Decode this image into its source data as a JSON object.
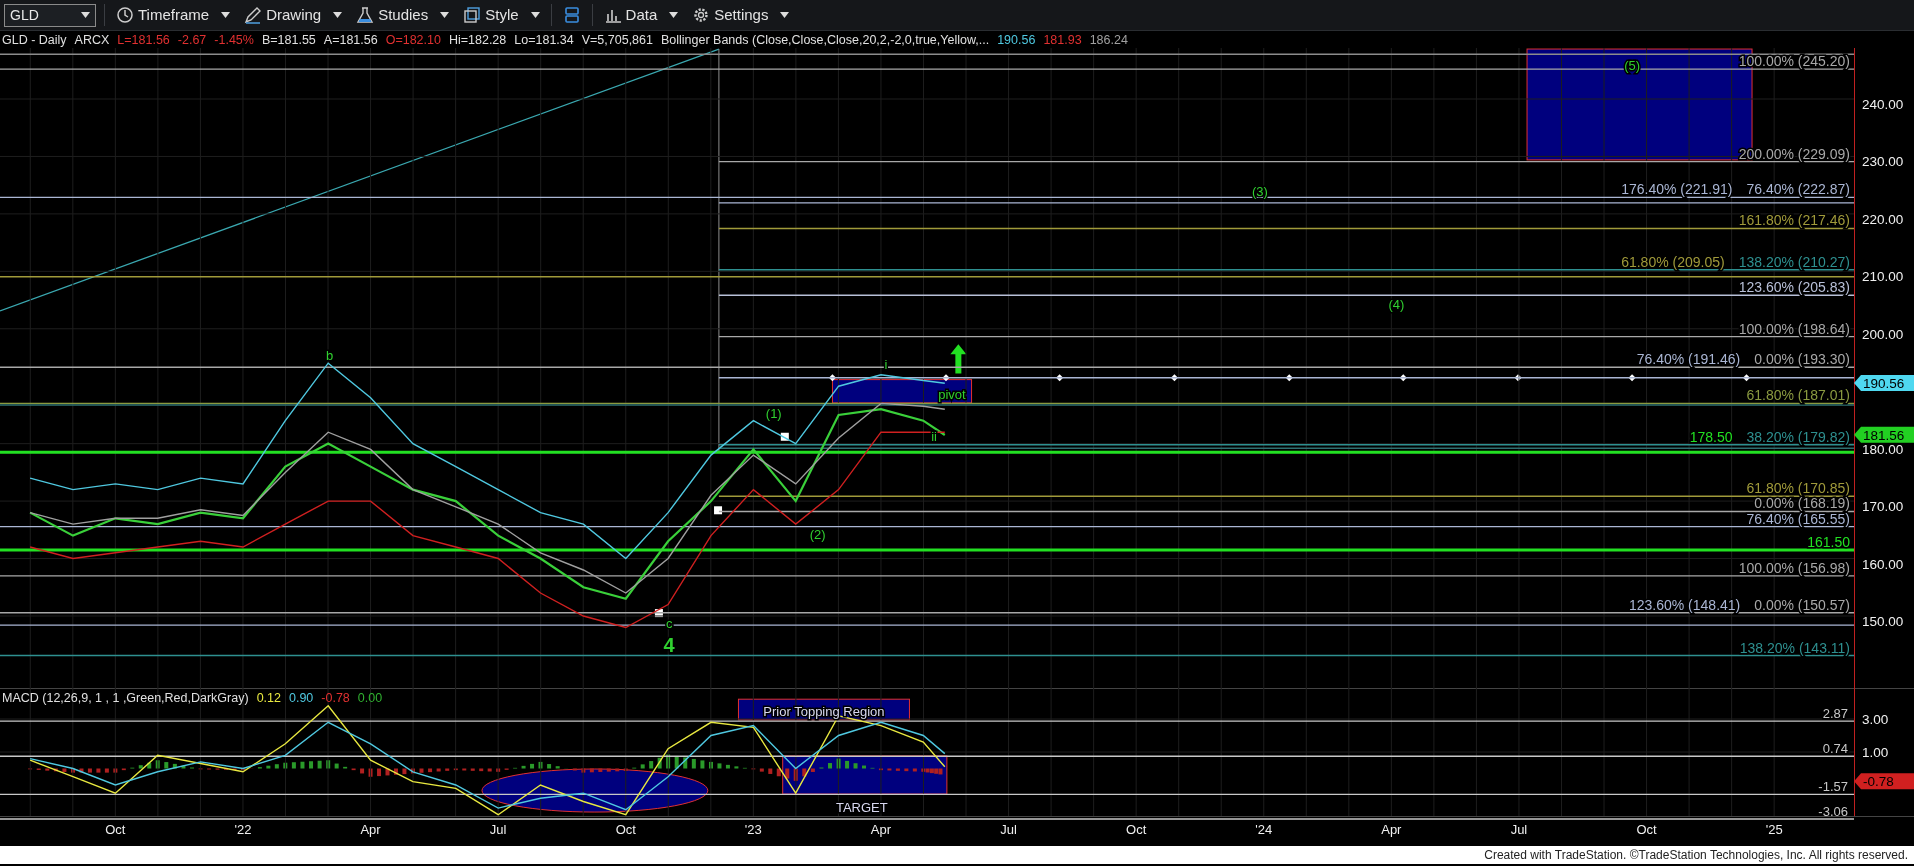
{
  "toolbar": {
    "symbol": "GLD",
    "menus": [
      {
        "label": "Timeframe",
        "kind": "clock"
      },
      {
        "label": "Drawing",
        "kind": "pencil"
      },
      {
        "label": "Studies",
        "kind": "flask"
      },
      {
        "label": "Style",
        "kind": "style"
      },
      {
        "kind": "layout"
      },
      {
        "label": "Data",
        "kind": "bars"
      },
      {
        "label": "Settings",
        "kind": "gear"
      }
    ]
  },
  "quote": [
    {
      "text": "GLD - Daily",
      "color": "#e0e0e0"
    },
    {
      "text": "ARCX",
      "color": "#e0e0e0"
    },
    {
      "text": "L=181.56",
      "color": "#e03030"
    },
    {
      "text": "-2.67",
      "color": "#e03030"
    },
    {
      "text": "-1.45%",
      "color": "#e03030"
    },
    {
      "text": "B=181.55",
      "color": "#e0e0e0"
    },
    {
      "text": "A=181.56",
      "color": "#e0e0e0"
    },
    {
      "text": "O=182.10",
      "color": "#e03030"
    },
    {
      "text": "Hi=182.28",
      "color": "#e0e0e0"
    },
    {
      "text": "Lo=181.34",
      "color": "#e0e0e0"
    },
    {
      "text": "V=5,705,861",
      "color": "#e0e0e0"
    },
    {
      "text": "Bollinger Bands (Close,Close,Close,20,2,-2,0,true,Yellow,...",
      "color": "#e0e0e0"
    },
    {
      "text": "190.56",
      "color": "#4fc8e0"
    },
    {
      "text": "181.93",
      "color": "#e03030"
    },
    {
      "text": "186.24",
      "color": "#a0a0a0"
    }
  ],
  "price_chart": {
    "price_badges": [
      {
        "label": "190.56",
        "color": "#4fd8f0"
      },
      {
        "label": "181.56",
        "color": "#22d022"
      }
    ],
    "chart_data": {
      "type": "line",
      "grid": true,
      "x": [
        21.583,
        21.667,
        21.75,
        21.833,
        21.917,
        22,
        22.083,
        22.167,
        22.25,
        22.333,
        22.417,
        22.5,
        22.583,
        22.667,
        22.75,
        22.833,
        22.917,
        23,
        23.083,
        23.167,
        23.25,
        23.333,
        23.375
      ],
      "series": [
        {
          "color": "#3ad03a",
          "values": [
            168,
            164,
            167,
            166,
            168,
            167,
            176,
            180,
            176,
            172,
            170,
            164,
            160,
            155,
            153,
            163,
            170,
            179,
            170,
            185,
            186,
            184,
            181.5
          ]
        },
        {
          "color": "#4fc8e0",
          "values": [
            174,
            172,
            173,
            172,
            174,
            173,
            184,
            194,
            188,
            180,
            176,
            172,
            168,
            166,
            160,
            168,
            178,
            184,
            180,
            190,
            192,
            191,
            190.5
          ]
        },
        {
          "color": "#a0a0a0",
          "values": [
            168,
            166,
            167,
            167,
            168.5,
            167.5,
            175,
            182,
            179,
            172,
            169,
            166,
            161,
            158,
            154,
            160,
            171,
            178,
            173,
            181,
            187,
            186.5,
            186
          ]
        },
        {
          "color": "#d02020",
          "values": [
            162,
            160,
            161,
            162,
            163,
            162,
            166,
            170,
            170,
            164,
            162,
            160,
            154,
            150,
            148,
            152,
            164,
            172,
            166,
            172,
            182,
            182,
            182
          ]
        }
      ],
      "xlim": [
        21.524,
        25.274
      ],
      "ylim": [
        137.46,
        248.88
      ],
      "yticks": [
        {
          "value": 240,
          "label": "240.00"
        },
        {
          "value": 230,
          "label": "230.00"
        },
        {
          "value": 220,
          "label": "220.00"
        },
        {
          "value": 210,
          "label": "210.00"
        },
        {
          "value": 200,
          "label": "200.00"
        },
        {
          "value": 180,
          "label": "180.00"
        },
        {
          "value": 170,
          "label": "170.00"
        },
        {
          "value": 160,
          "label": "160.00"
        },
        {
          "value": 150,
          "label": "150.00"
        }
      ],
      "ref_lines": [
        {
          "axis": "y",
          "value": 247.8,
          "color": "#8c8c8c"
        },
        {
          "axis": "y",
          "value": 245.2,
          "label": "100.00% (245.20)",
          "color": "#a8a8a8"
        },
        {
          "axis": "y",
          "value": 229.09,
          "label": "200.00% (229.09)",
          "color": "#a8a8a8"
        },
        {
          "axis": "y",
          "value": 222.87,
          "label": "76.40% (222.87)",
          "color": "#aab6d4"
        },
        {
          "axis": "y",
          "value": 221.91,
          "label": "176.40% (221.91)",
          "color": "#aab6d4"
        },
        {
          "axis": "y",
          "value": 217.46,
          "label": "161.80% (217.46)",
          "color": "#a09a3a"
        },
        {
          "axis": "y",
          "value": 210.27,
          "label": "138.20% (210.27)",
          "color": "#2e9090"
        },
        {
          "axis": "y",
          "value": 209.05,
          "label": "61.80% (209.05)",
          "color": "#a09a3a"
        },
        {
          "axis": "y",
          "value": 205.83,
          "label": "123.60% (205.83)",
          "color": "#b8c0d8"
        },
        {
          "axis": "y",
          "value": 198.64,
          "label": "100.00% (198.64)",
          "color": "#a8a8a8"
        },
        {
          "axis": "y",
          "value": 193.3,
          "label": "0.00% (193.30)",
          "color": "#a8a8a8"
        },
        {
          "axis": "y",
          "value": 191.46,
          "label": "76.40% (191.46)",
          "color": "#aab6d4"
        },
        {
          "axis": "y",
          "value": 187.01,
          "label": "61.80% (187.01)",
          "color": "#8a9a40"
        },
        {
          "axis": "y",
          "value": 186.72,
          "color": "#2e7070"
        },
        {
          "axis": "y",
          "value": 179.82,
          "label": "38.20% (179.82)",
          "color": "#2e9090"
        },
        {
          "axis": "y",
          "value": 179.2,
          "color": "#2e7070"
        },
        {
          "axis": "y",
          "value": 178.5,
          "label": "178.50",
          "color": "#22e022"
        },
        {
          "axis": "y",
          "value": 170.85,
          "label": "61.80% (170.85)",
          "color": "#a09a3a"
        },
        {
          "axis": "y",
          "value": 168.19,
          "label": "0.00% (168.19)",
          "color": "#a8a8a8"
        },
        {
          "axis": "y",
          "value": 165.55,
          "label": "76.40% (165.55)",
          "color": "#aab6d4"
        },
        {
          "axis": "y",
          "value": 161.5,
          "label": "161.50",
          "color": "#22e022"
        },
        {
          "axis": "y",
          "value": 156.98,
          "label": "100.00% (156.98)",
          "color": "#a8a8a8"
        },
        {
          "axis": "y",
          "value": 150.57,
          "label": "0.00% (150.57)",
          "color": "#a8a8a8"
        },
        {
          "axis": "y",
          "value": 148.41,
          "label": "123.60% (148.41)",
          "color": "#aab6d4"
        },
        {
          "axis": "y",
          "value": 143.11,
          "label": "138.20% (143.11)",
          "color": "#2e9090"
        }
      ],
      "annotations": [
        "b",
        "(1)",
        "(2)",
        "(3)",
        "(4)",
        "(5)",
        "c",
        "4",
        "i",
        "ii",
        "pivot"
      ]
    }
  },
  "macd": {
    "title": "MACD (12,26,9, 1 , 1 ,Green,Red,DarkGray)",
    "readings": [
      {
        "text": "0.12",
        "color": "#e8e840"
      },
      {
        "text": "0.90",
        "color": "#4fc8e0"
      },
      {
        "text": "-0.78",
        "color": "#e03030"
      },
      {
        "text": "0.00",
        "color": "#30b030"
      }
    ],
    "badge": {
      "label": "-0.78",
      "color": "#d02020"
    },
    "chart_data": {
      "type": "line",
      "grid": true,
      "x": [
        21.583,
        21.667,
        21.75,
        21.833,
        21.917,
        22,
        22.083,
        22.167,
        22.25,
        22.333,
        22.417,
        22.5,
        22.583,
        22.667,
        22.75,
        22.833,
        22.917,
        23,
        23.083,
        23.167,
        23.25,
        23.333,
        23.375
      ],
      "series": [
        {
          "color": "#e8e840",
          "values": [
            0.5,
            -0.5,
            -1.5,
            0.8,
            0.3,
            -0.2,
            1.5,
            3.8,
            0.5,
            -0.8,
            -1.2,
            -2.8,
            -1.0,
            -2.0,
            -2.8,
            1.2,
            2.8,
            2.5,
            -1.5,
            3.2,
            2.6,
            1.6,
            0.1
          ]
        },
        {
          "color": "#4fc8e0",
          "values": [
            0.6,
            0,
            -1,
            -0.2,
            0.4,
            0,
            0.8,
            2.8,
            1.5,
            -0.2,
            -1,
            -2.4,
            -1.8,
            -1.5,
            -2.5,
            -0.5,
            2.0,
            2.6,
            0,
            2.0,
            2.8,
            2.0,
            0.9
          ]
        }
      ],
      "xlim": [
        21.524,
        25.274
      ],
      "ylim": [
        -2.879,
        4.879
      ],
      "xticks": [
        {
          "value": 21.75,
          "label": "Oct"
        },
        {
          "value": 22,
          "label": "'22"
        },
        {
          "value": 22.25,
          "label": "Apr"
        },
        {
          "value": 22.5,
          "label": "Jul"
        },
        {
          "value": 22.75,
          "label": "Oct"
        },
        {
          "value": 23,
          "label": "'23"
        },
        {
          "value": 23.25,
          "label": "Apr"
        },
        {
          "value": 23.5,
          "label": "Jul"
        },
        {
          "value": 23.75,
          "label": "Oct"
        },
        {
          "value": 24,
          "label": "'24"
        },
        {
          "value": 24.25,
          "label": "Apr"
        },
        {
          "value": 24.5,
          "label": "Jul"
        },
        {
          "value": 24.75,
          "label": "Oct"
        },
        {
          "value": 25,
          "label": "'25"
        }
      ],
      "yticks": [
        {
          "value": 3,
          "label": "3.00"
        },
        {
          "value": 1,
          "label": "1.00"
        }
      ],
      "ref_lines": [
        {
          "axis": "y",
          "value": 2.87,
          "label": "2.87",
          "color": "#c8c8c8"
        },
        {
          "axis": "y",
          "value": 0.74,
          "label": "0.74",
          "color": "#c8c8c8"
        },
        {
          "axis": "y",
          "value": -1.57,
          "label": "-1.57",
          "color": "#c8c8c8"
        },
        {
          "axis": "y",
          "value": -3.06,
          "label": "-3.06",
          "color": "#c8c8c8"
        }
      ],
      "annotations": [
        "Prior Topping Region",
        "TARGET"
      ]
    }
  },
  "footer": "Created with TradeStation. ©TradeStation Technologies, Inc. All rights reserved."
}
